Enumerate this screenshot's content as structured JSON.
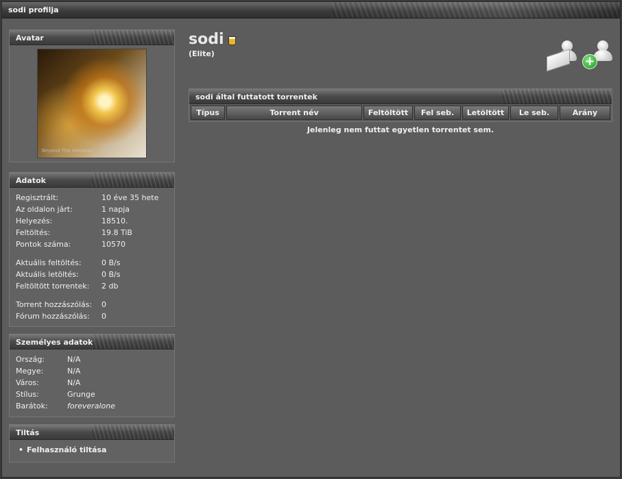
{
  "page_title": "sodi profilja",
  "avatar": {
    "heading": "Avatar",
    "caption": "Beyond The Horizons"
  },
  "stats": {
    "heading": "Adatok",
    "rows": [
      {
        "k": "Regisztrált:",
        "v": "10 éve 35 hete"
      },
      {
        "k": "Az oldalon járt:",
        "v": "1 napja"
      },
      {
        "k": "Helyezés:",
        "v": "18510."
      },
      {
        "k": "Feltöltés:",
        "v": "19.8 TiB"
      },
      {
        "k": "Pontok száma:",
        "v": "10570"
      },
      {
        "k": "Aktuális feltöltés:",
        "v": "0 B/s"
      },
      {
        "k": "Aktuális letöltés:",
        "v": "0 B/s"
      },
      {
        "k": "Feltöltött torrentek:",
        "v": "2 db"
      },
      {
        "k": "Torrent hozzászólás:",
        "v": "0"
      },
      {
        "k": "Fórum hozzászólás:",
        "v": "0"
      }
    ]
  },
  "personal": {
    "heading": "Személyes adatok",
    "rows": [
      {
        "k": "Ország:",
        "v": "N/A"
      },
      {
        "k": "Megye:",
        "v": "N/A"
      },
      {
        "k": "Város:",
        "v": "N/A"
      },
      {
        "k": "Stílus:",
        "v": "Grunge"
      },
      {
        "k": "Barátok:",
        "v": "foreveralone"
      }
    ]
  },
  "ban": {
    "heading": "Tiltás",
    "item": "Felhasználó tiltása"
  },
  "profile": {
    "username": "sodi",
    "rank": "(Elite)"
  },
  "icons": [
    "send-message-icon",
    "add-friend-icon"
  ],
  "torrents": {
    "heading": "sodi által futtatott torrentek",
    "columns": [
      "Típus",
      "Torrent név",
      "Feltöltött",
      "Fel seb.",
      "Letöltött",
      "Le seb.",
      "Arány"
    ],
    "empty_message": "Jelenleg nem futtat egyetlen torrentet sem."
  }
}
